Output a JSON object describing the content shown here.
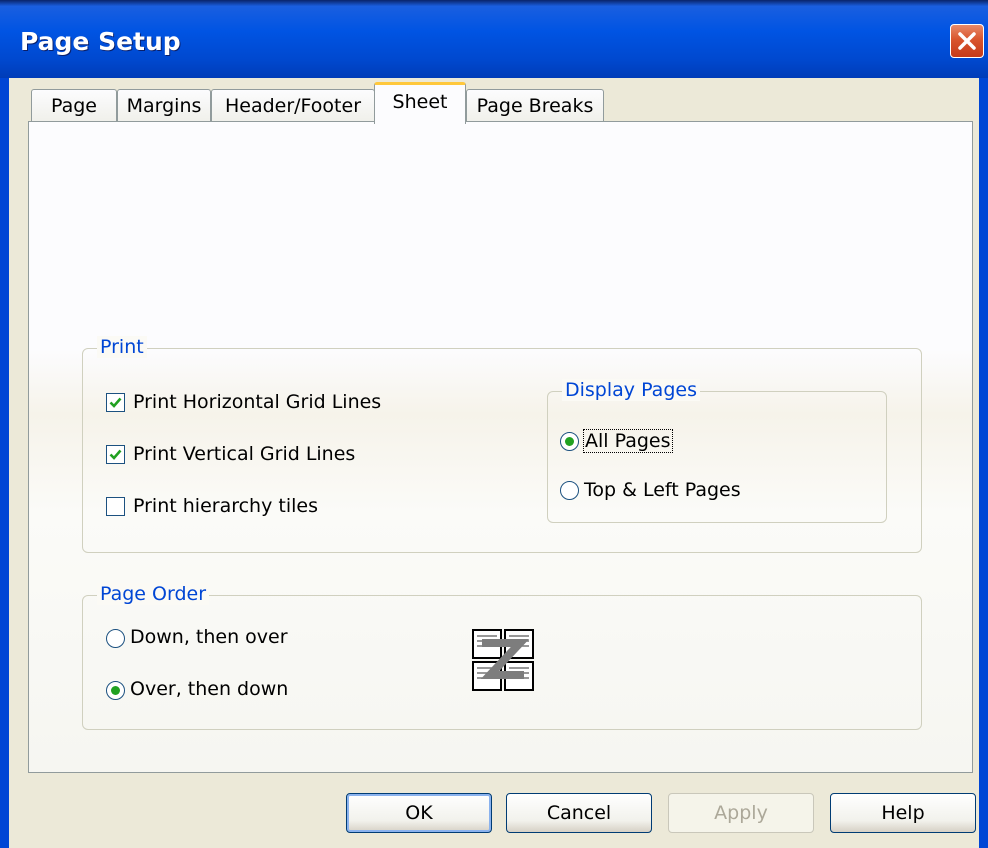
{
  "window": {
    "title": "Page Setup",
    "close_icon": "close-icon"
  },
  "tabs": [
    {
      "label": "Page",
      "active": false
    },
    {
      "label": "Margins",
      "active": false
    },
    {
      "label": "Header/Footer",
      "active": false
    },
    {
      "label": "Sheet",
      "active": true
    },
    {
      "label": "Page Breaks",
      "active": false
    }
  ],
  "print_group": {
    "legend": "Print",
    "options": [
      {
        "label": "Print Horizontal Grid Lines",
        "checked": true
      },
      {
        "label": "Print Vertical Grid Lines",
        "checked": true
      },
      {
        "label": "Print hierarchy tiles",
        "checked": false
      }
    ],
    "display_pages": {
      "legend": "Display Pages",
      "options": [
        {
          "label": "All Pages",
          "selected": true
        },
        {
          "label": "Top & Left Pages",
          "selected": false
        }
      ]
    }
  },
  "page_order": {
    "legend": "Page Order",
    "options": [
      {
        "label": "Down, then over",
        "selected": false
      },
      {
        "label": "Over, then down",
        "selected": true
      }
    ],
    "preview_icon": "page-order-preview-icon"
  },
  "buttons": {
    "ok": "OK",
    "cancel": "Cancel",
    "apply": "Apply",
    "help": "Help"
  },
  "colors": {
    "title_bar": "#0054e3",
    "accent_legend": "#0046d5",
    "active_tab_highlight": "#ffc83c",
    "check_mark": "#21a121"
  }
}
